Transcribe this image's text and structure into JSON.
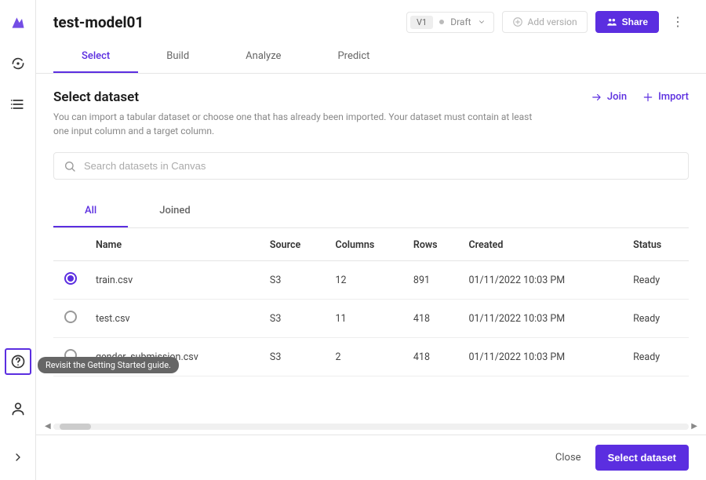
{
  "header": {
    "title": "test-model01",
    "version_label": "V1",
    "version_state": "Draft",
    "add_version_label": "Add version",
    "share_label": "Share"
  },
  "top_tabs": {
    "items": [
      {
        "label": "Select",
        "active": true
      },
      {
        "label": "Build",
        "active": false
      },
      {
        "label": "Analyze",
        "active": false
      },
      {
        "label": "Predict",
        "active": false
      }
    ]
  },
  "section": {
    "title": "Select dataset",
    "description": "You can import a tabular dataset or choose one that has already been imported. Your dataset must contain at least one input column and a target column.",
    "join_label": "Join",
    "import_label": "Import",
    "search_placeholder": "Search datasets in Canvas"
  },
  "sub_tabs": {
    "items": [
      {
        "label": "All",
        "active": true
      },
      {
        "label": "Joined",
        "active": false
      }
    ]
  },
  "table": {
    "headers": {
      "name": "Name",
      "source": "Source",
      "columns": "Columns",
      "rows": "Rows",
      "created": "Created",
      "status": "Status"
    },
    "rows": [
      {
        "selected": true,
        "name": "train.csv",
        "source": "S3",
        "columns": "12",
        "rows": "891",
        "created": "01/11/2022 10:03 PM",
        "status": "Ready"
      },
      {
        "selected": false,
        "name": "test.csv",
        "source": "S3",
        "columns": "11",
        "rows": "418",
        "created": "01/11/2022 10:03 PM",
        "status": "Ready"
      },
      {
        "selected": false,
        "name": "gender_submission.csv",
        "source": "S3",
        "columns": "2",
        "rows": "418",
        "created": "01/11/2022 10:03 PM",
        "status": "Ready"
      }
    ]
  },
  "tooltip": "Revisit the Getting Started guide.",
  "footer": {
    "close_label": "Close",
    "primary_label": "Select dataset"
  }
}
